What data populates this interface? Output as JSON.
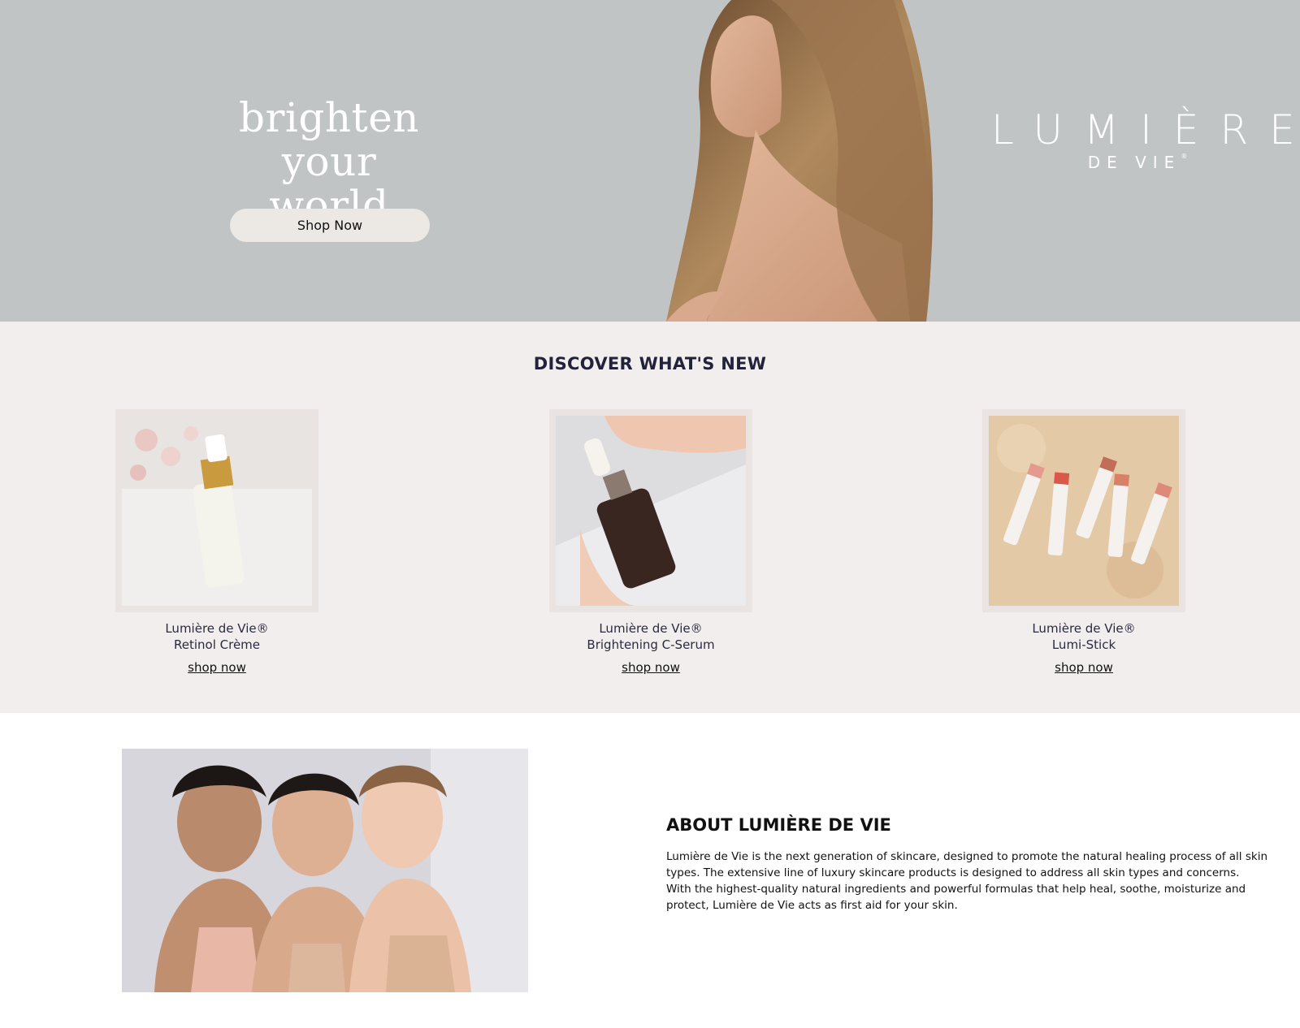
{
  "hero": {
    "headline_line1": "brighten",
    "headline_line2": "your world",
    "cta_label": "Shop Now",
    "brand_name": "LUMIÈRE",
    "brand_sub": "DE VIE",
    "brand_mark": "®"
  },
  "new_section": {
    "title": "DISCOVER WHAT'S NEW",
    "products": [
      {
        "brand": "Lumière de Vie®",
        "name": "Retinol Crème",
        "link": "shop now"
      },
      {
        "brand": "Lumière de Vie®",
        "name": "Brightening C-Serum",
        "link": "shop now"
      },
      {
        "brand": "Lumière de Vie®",
        "name": "Lumi-Stick",
        "link": "shop now"
      }
    ]
  },
  "about": {
    "title": "ABOUT LUMIÈRE DE VIE",
    "body": "Lumière de Vie is the next generation of skincare, designed to promote the natural healing process of all skin types. The extensive line of luxury skincare products is designed to address all skin types and concerns. With the highest-quality natural ingredients and powerful formulas that help heal, soothe, moisturize and protect, Lumière de Vie acts as first aid for your skin."
  },
  "colors": {
    "hero_bg": "#c1c4c4",
    "section_bg": "#f3eeee",
    "title_navy": "#22223a",
    "button_bg": "#ece8e4"
  }
}
